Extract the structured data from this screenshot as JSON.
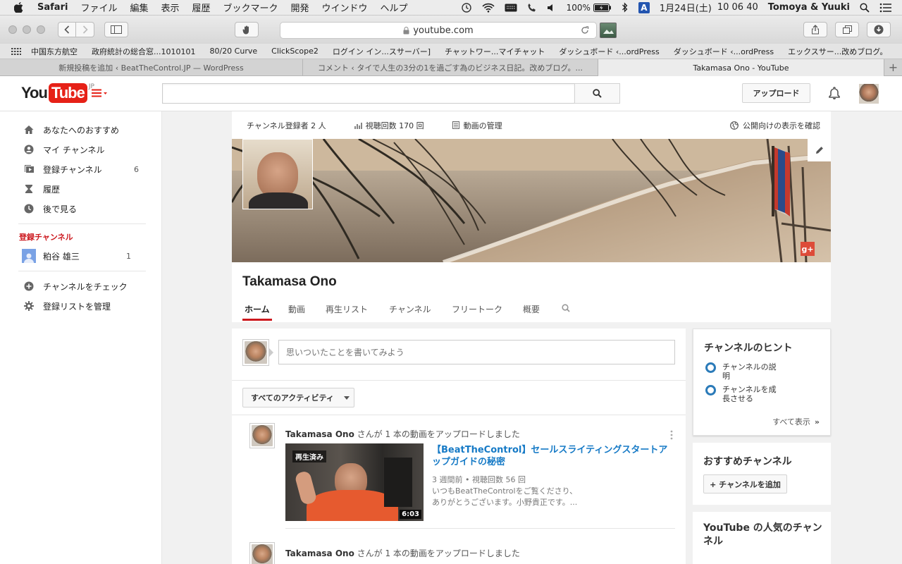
{
  "menubar": {
    "app": "Safari",
    "items": [
      "ファイル",
      "編集",
      "表示",
      "履歴",
      "ブックマーク",
      "開発",
      "ウインドウ",
      "ヘルプ"
    ],
    "battery": "100%",
    "date": "1月24日(土)",
    "time": "10 06 40",
    "user": "Tomoya & Yuuki",
    "input_method": "A"
  },
  "browser": {
    "url": "youtube.com",
    "bookmarks": [
      "中国东方航空",
      "政府統計の総合窓...1010101",
      "80/20 Curve",
      "ClickScope2",
      "ログイン イン...スサーバー]",
      "チャットワー...マイチャット",
      "ダッシュボード ‹...ordPress",
      "ダッシュボード ‹...ordPress",
      "エックスサー...改めブログ。"
    ],
    "tabs": [
      {
        "label": "新規投稿を追加 ‹ BeatTheControl.JP — WordPress",
        "active": false
      },
      {
        "label": "コメント ‹ タイで人生の3分の1を過ごす為のビジネス日記。改めブログ。...",
        "active": false
      },
      {
        "label": "Takamasa Ono - YouTube",
        "active": true
      }
    ]
  },
  "youtube": {
    "logo_you": "You",
    "logo_tube": "Tube",
    "logo_region": "JP",
    "search_placeholder": "",
    "upload_label": "アップロード",
    "colors": {
      "brand_red": "#e62117",
      "link_blue": "#167ac6",
      "hint_blue": "#2b7bb9"
    }
  },
  "sidebar": {
    "items": [
      {
        "label": "あなたへのおすすめ",
        "icon": "home-icon"
      },
      {
        "label": "マイ チャンネル",
        "icon": "person-icon"
      },
      {
        "label": "登録チャンネル",
        "icon": "subscriptions-icon",
        "count": "6"
      },
      {
        "label": "履歴",
        "icon": "hourglass-icon"
      },
      {
        "label": "後で見る",
        "icon": "clock-icon"
      }
    ],
    "section_title": "登録チャンネル",
    "subscriptions": [
      {
        "label": "粕谷 雄三",
        "count": "1"
      }
    ],
    "bottom": [
      {
        "label": "チャンネルをチェック",
        "icon": "add-circle-icon"
      },
      {
        "label": "登録リストを管理",
        "icon": "gear-icon"
      }
    ]
  },
  "channel": {
    "subscribers": "チャンネル登録者 2 人",
    "views": "視聴回数 170 回",
    "manage": "動画の管理",
    "public_view": "公開向けの表示を確認",
    "name": "Takamasa Ono",
    "tabs": [
      "ホーム",
      "動画",
      "再生リスト",
      "チャンネル",
      "フリートーク",
      "概要"
    ],
    "active_tab": "ホーム"
  },
  "feed": {
    "post_placeholder": "思いついたことを書いてみよう",
    "filter": "すべてのアクティビティ",
    "activities": [
      {
        "author": "Takamasa Ono",
        "action": "さんが 1 本の動画をアップロードしました",
        "video_title": "【BeatTheControl】セールスライティングスタートアップガイドの秘密",
        "watched_badge": "再生済み",
        "duration": "6:03",
        "meta": "3 週間前 • 視聴回数 56 回",
        "desc_line1": "いつもBeatTheControlをご覧くださり、",
        "desc_line2": "ありがとうございます。小野貴正です。..."
      },
      {
        "author": "Takamasa Ono",
        "action": "さんが 1 本の動画をアップロードしました"
      }
    ]
  },
  "right": {
    "hints_title": "チャンネルのヒント",
    "hint1_a": "チャンネルの説",
    "hint1_b": "明",
    "hint2_a": "チャンネルを成",
    "hint2_b": "長させる",
    "show_all": "すべて表示",
    "recommended_title": "おすすめチャンネル",
    "add_channel": "+ チャンネルを追加",
    "popular_a": "YouTube の人気のチャン",
    "popular_b": "ネル"
  }
}
